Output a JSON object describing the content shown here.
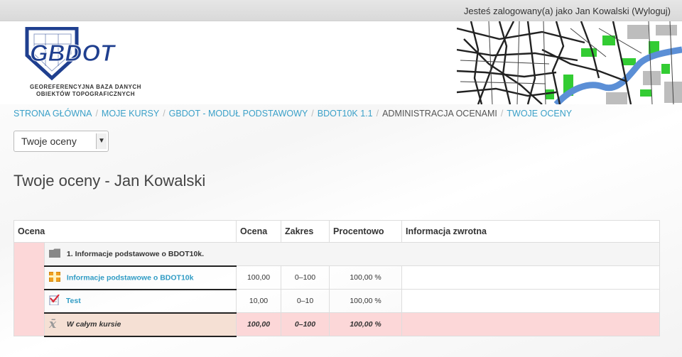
{
  "topbar": {
    "login_prefix": "Jesteś zalogowany(a) jako",
    "user_name": "Jan Kowalski",
    "logout_label": "(Wyloguj)"
  },
  "logo": {
    "text": "GBDOT",
    "caption_line1": "GEOREFERENCYJNA BAZA DANYCH",
    "caption_line2": "OBIEKTÓW TOPOGRAFICZNYCH",
    "color": "#1f3f8f"
  },
  "breadcrumb": {
    "items": [
      "STRONA GŁÓWNA",
      "MOJE KURSY",
      "GBDOT - MODUŁ PODSTAWOWY",
      "BDOT10K 1.1",
      "ADMINISTRACJA OCENAMI",
      "TWOJE OCENY"
    ],
    "separator": "/"
  },
  "report_select": {
    "value": "Twoje oceny"
  },
  "page_title": "Twoje oceny - Jan Kowalski",
  "table": {
    "headers": [
      "Ocena",
      "Ocena",
      "Zakres",
      "Procentowo",
      "Informacja zwrotna"
    ],
    "category": "1. Informacje podstawowe o BDOT10k.",
    "rows": [
      {
        "name": "Informacje podstawowe o BDOT10k",
        "grade": "100,00",
        "range": "0–100",
        "percent": "100,00 %",
        "feedback": "",
        "icon": "package-icon"
      },
      {
        "name": "Test",
        "grade": "10,00",
        "range": "0–10",
        "percent": "100,00 %",
        "feedback": "",
        "icon": "quiz-icon"
      }
    ],
    "total": {
      "name": "W całym kursie",
      "grade": "100,00",
      "range": "0–100",
      "percent": "100,00 %",
      "feedback": "",
      "icon": "mean-icon"
    }
  },
  "colors": {
    "link": "#3aa0c8",
    "total_bg": "#fcd7d8",
    "map_green": "#33cc33",
    "map_river": "#5b8fd6"
  }
}
